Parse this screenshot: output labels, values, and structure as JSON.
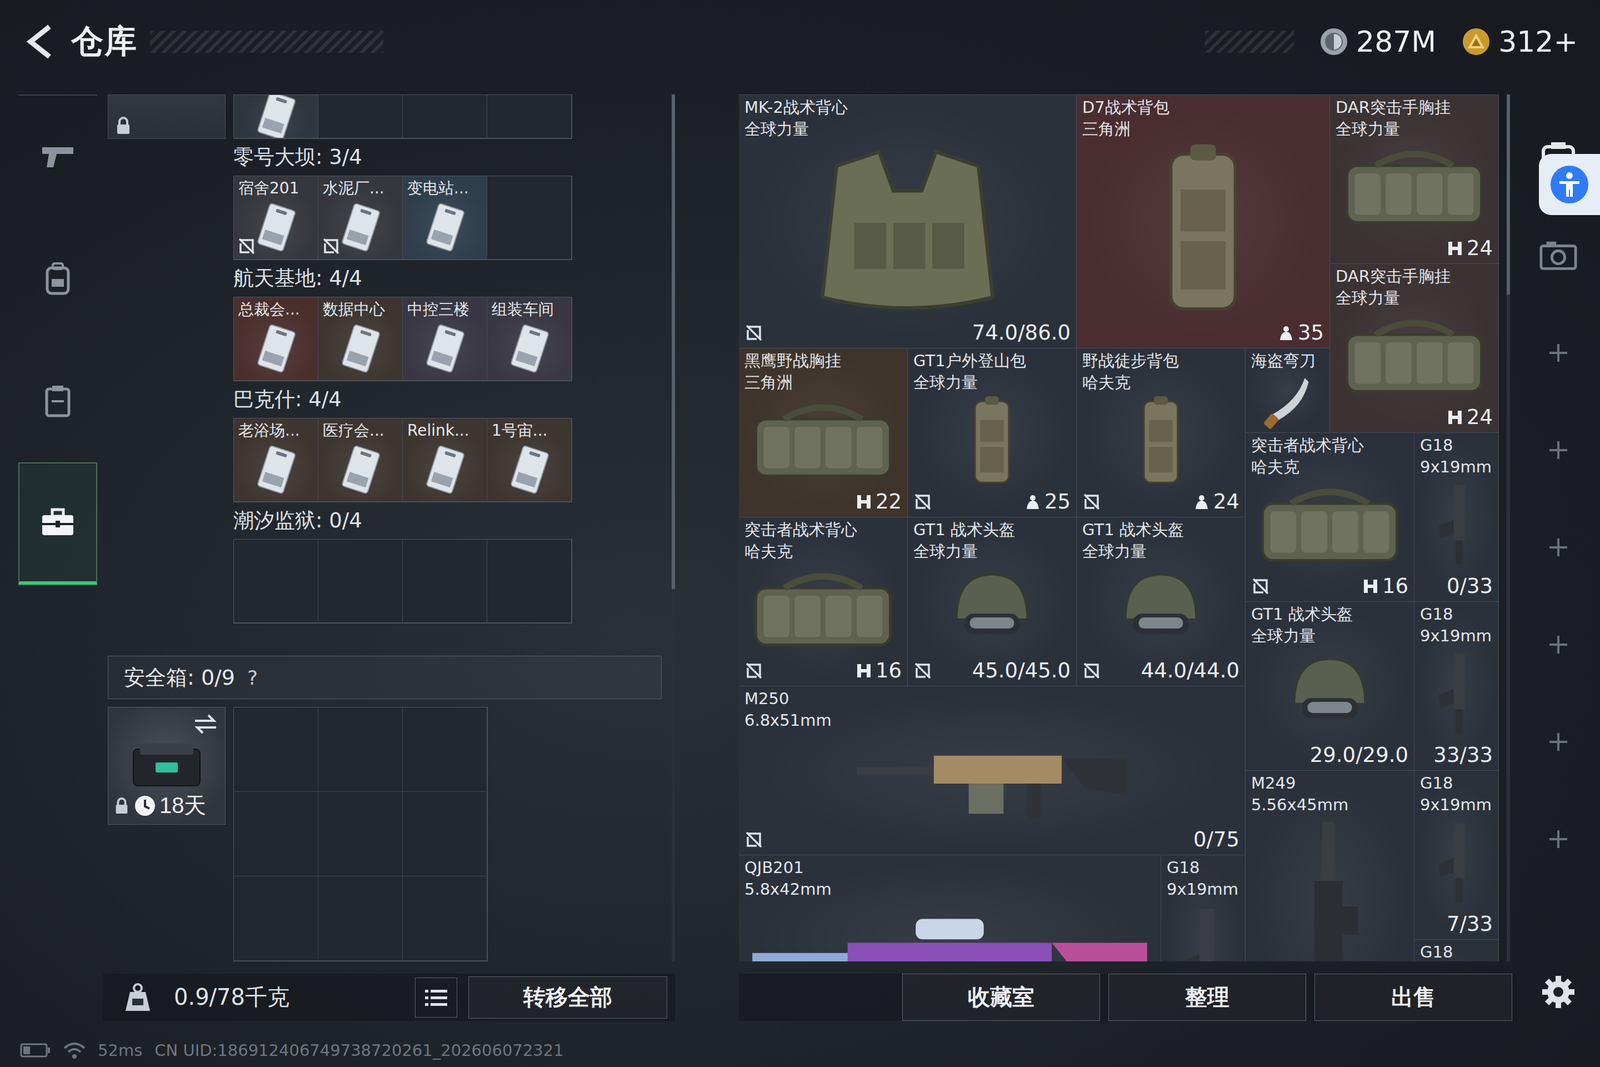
{
  "header": {
    "title": "仓库",
    "currencies": [
      {
        "kind": "coin",
        "value": "287M"
      },
      {
        "kind": "token",
        "value": "312+"
      }
    ]
  },
  "nav": [
    {
      "kind": "weapon",
      "selected": false
    },
    {
      "kind": "gear",
      "selected": false
    },
    {
      "kind": "case",
      "selected": false
    },
    {
      "kind": "briefcase",
      "selected": true
    }
  ],
  "top_strip": {
    "locked": true,
    "slots": [
      {
        "kind": "key",
        "color": "#2f3640"
      },
      {
        "kind": "empty"
      },
      {
        "kind": "empty"
      },
      {
        "kind": "empty"
      }
    ]
  },
  "key_sections": [
    {
      "title": "零号大坝: 3/4",
      "keys": [
        {
          "kind": "key",
          "label": "宿舍201",
          "marked": true,
          "color": "#35373d"
        },
        {
          "kind": "key",
          "label": "水泥厂...",
          "marked": true,
          "color": "#35373d"
        },
        {
          "kind": "key",
          "label": "变电站...",
          "marked": false,
          "color": "#2f3e4c"
        },
        {
          "kind": "empty"
        }
      ]
    },
    {
      "title": "航天基地: 4/4",
      "keys": [
        {
          "kind": "key",
          "label": "总裁会...",
          "marked": false,
          "color": "#4a2f2d"
        },
        {
          "kind": "key",
          "label": "数据中心",
          "marked": false,
          "color": "#3d3530"
        },
        {
          "kind": "key",
          "label": "中控三楼",
          "marked": false,
          "color": "#383743"
        },
        {
          "kind": "key",
          "label": "组装车间",
          "marked": false,
          "color": "#383743"
        }
      ]
    },
    {
      "title": "巴克什: 4/4",
      "keys": [
        {
          "kind": "key",
          "label": "老浴场...",
          "marked": false,
          "color": "#3d3530"
        },
        {
          "kind": "key",
          "label": "医疗会...",
          "marked": false,
          "color": "#3d3530"
        },
        {
          "kind": "key",
          "label": "Relink...",
          "marked": false,
          "color": "#3d3530"
        },
        {
          "kind": "key",
          "label": "1号宙...",
          "marked": false,
          "color": "#3d3530"
        }
      ]
    },
    {
      "title": "潮汐监狱: 0/4",
      "keys": [
        {
          "kind": "empty"
        },
        {
          "kind": "empty"
        },
        {
          "kind": "empty"
        },
        {
          "kind": "empty"
        }
      ]
    }
  ],
  "safe_box": {
    "label": "安全箱: 0/9",
    "help": "?",
    "item": {
      "days": "18天",
      "locked": true
    },
    "slots": [
      {
        "kind": "empty"
      },
      {
        "kind": "empty"
      },
      {
        "kind": "empty"
      },
      {
        "kind": "empty"
      },
      {
        "kind": "empty"
      },
      {
        "kind": "empty"
      },
      {
        "kind": "empty"
      },
      {
        "kind": "empty"
      },
      {
        "kind": "empty"
      }
    ]
  },
  "left_footer": {
    "weight": "0.9/78千克",
    "transfer": "转移全部"
  },
  "items": [
    {
      "name": "MK-2战术背心",
      "sub": "全球力量",
      "kind": "vest",
      "color": "#2b313b",
      "marked": true,
      "value": "74.0/86.0"
    },
    {
      "name": "D7战术背包",
      "sub": "三角洲",
      "kind": "backpack",
      "color": "#4a2d30",
      "marked": false,
      "badge": {
        "kind": "capacity",
        "text": "35"
      }
    },
    {
      "name": "DAR突击手胸挂",
      "sub": "全球力量",
      "kind": "rig",
      "color": "#3b3233",
      "marked": false,
      "badge": {
        "kind": "slots",
        "text": "24"
      }
    },
    {
      "name": "DAR突击手胸挂",
      "sub": "全球力量",
      "kind": "rig",
      "color": "#3b3233",
      "marked": false,
      "badge": {
        "kind": "slots",
        "text": "24"
      }
    },
    {
      "name": "黑鹰野战胸挂",
      "sub": "三角洲",
      "kind": "rig",
      "color": "#3e342b",
      "marked": false,
      "badge": {
        "kind": "slots",
        "text": "22"
      }
    },
    {
      "name": "GT1户外登山包",
      "sub": "全球力量",
      "kind": "backpack",
      "color": "#2b313b",
      "marked": true,
      "badge": {
        "kind": "capacity",
        "text": "25"
      }
    },
    {
      "name": "野战徒步背包",
      "sub": "哈夫克",
      "kind": "backpack",
      "color": "#2b313b",
      "marked": true,
      "badge": {
        "kind": "capacity",
        "text": "24"
      }
    },
    {
      "name": "海盗弯刀",
      "kind": "knife",
      "color": "#2b313b",
      "marked": false
    },
    {
      "name": "突击者战术背心",
      "sub": "哈夫克",
      "kind": "rig",
      "color": "#2b313b",
      "marked": true,
      "badge": {
        "kind": "slots",
        "text": "16"
      }
    },
    {
      "name": "G18",
      "sub": "9x19mm",
      "kind": "pistol",
      "color": "#2b313b",
      "marked": false,
      "value": "0/33"
    },
    {
      "name": "突击者战术背心",
      "sub": "哈夫克",
      "kind": "rig",
      "color": "#2b313b",
      "marked": true,
      "badge": {
        "kind": "slots",
        "text": "16"
      }
    },
    {
      "name": "GT1 战术头盔",
      "sub": "全球力量",
      "kind": "helmet",
      "color": "#2b313b",
      "marked": true,
      "value": "45.0/45.0"
    },
    {
      "name": "GT1 战术头盔",
      "sub": "全球力量",
      "kind": "helmet",
      "color": "#2b313b",
      "marked": true,
      "value": "44.0/44.0"
    },
    {
      "name": "GT1 战术头盔",
      "sub": "全球力量",
      "kind": "helmet",
      "color": "#2b313b",
      "marked": false,
      "value": "29.0/29.0"
    },
    {
      "name": "G18",
      "sub": "9x19mm",
      "kind": "pistol",
      "color": "#2b313b",
      "marked": false,
      "value": "33/33"
    },
    {
      "name": "M250",
      "sub": "6.8x51mm",
      "kind": "mg",
      "color": "#2b313b",
      "marked": true,
      "value": "0/75"
    },
    {
      "name": "M249",
      "sub": "5.56x45mm",
      "kind": "lmg",
      "color": "#2b313b",
      "marked": false
    },
    {
      "name": "G18",
      "sub": "9x19mm",
      "kind": "pistol",
      "color": "#2b313b",
      "marked": false,
      "value": "7/33"
    },
    {
      "name": "QJB201",
      "sub": "5.8x42mm",
      "kind": "rifle",
      "color": "#2b313b",
      "marked": false
    },
    {
      "name": "G18",
      "sub": "9x19mm",
      "kind": "pistol",
      "color": "#2b313b",
      "marked": false
    },
    {
      "name": "G18",
      "kind": "pistol",
      "color": "#2b313b",
      "marked": false
    }
  ],
  "buttons": [
    "收藏室",
    "整理",
    "出售"
  ],
  "status_bar": {
    "ping": "52ms",
    "uid": "CN UID:186912406749738720261_202606072321"
  }
}
